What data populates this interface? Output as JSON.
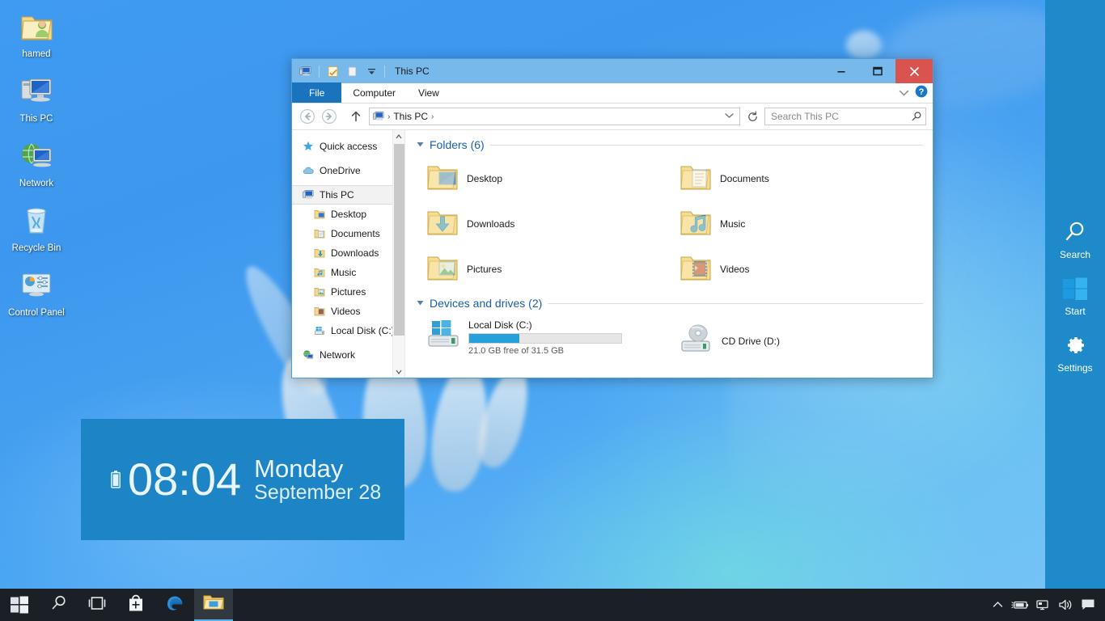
{
  "desktop": {
    "icons": [
      {
        "label": "hamed",
        "icon": "user-folder-icon"
      },
      {
        "label": "This PC",
        "icon": "computer-icon"
      },
      {
        "label": "Network",
        "icon": "network-icon"
      },
      {
        "label": "Recycle Bin",
        "icon": "recycle-bin-icon"
      },
      {
        "label": "Control Panel",
        "icon": "control-panel-icon"
      }
    ]
  },
  "clock_tile": {
    "time": "08:04",
    "day": "Monday",
    "month_day": "September 28",
    "battery_icon": "battery-icon",
    "background": "#1d84c6"
  },
  "charms": {
    "background": "#1f8ac9",
    "items": [
      {
        "label": "Search",
        "icon": "search-icon"
      },
      {
        "label": "Start",
        "icon": "windows-logo-icon"
      },
      {
        "label": "Settings",
        "icon": "gear-icon"
      }
    ]
  },
  "explorer": {
    "titlebar": {
      "title": "This PC",
      "app_icon": "this-pc-icon",
      "quick_access": [
        {
          "name": "properties-icon"
        },
        {
          "name": "new-folder-icon"
        },
        {
          "name": "customize-qat-chevron-icon"
        }
      ],
      "minimize_label": "–",
      "maximize_label": "▭",
      "close_label": "×",
      "close_color": "#d9534f",
      "background": "#78b9ec"
    },
    "ribbon": {
      "tabs": [
        {
          "label": "File",
          "active": true
        },
        {
          "label": "Computer",
          "active": false
        },
        {
          "label": "View",
          "active": false
        }
      ],
      "expand_icon": "chevron-down-icon",
      "help_icon": "help-icon",
      "file_tab_color": "#1a74bd"
    },
    "address_bar": {
      "back_icon": "back-arrow-icon",
      "forward_icon": "forward-arrow-icon",
      "up_icon": "up-arrow-icon",
      "crumb_icon": "this-pc-icon",
      "crumbs": [
        "This PC"
      ],
      "separator": "›",
      "dropdown_icon": "chevron-down-icon",
      "refresh_icon": "refresh-icon",
      "search_placeholder": "Search This PC",
      "search_value": "",
      "search_icon": "search-icon"
    },
    "nav_pane": {
      "items": [
        {
          "label": "Quick access",
          "icon": "star-icon",
          "level": 0,
          "selected": false
        },
        {
          "label": "OneDrive",
          "icon": "onedrive-icon",
          "level": 0,
          "selected": false
        },
        {
          "label": "This PC",
          "icon": "this-pc-icon",
          "level": 0,
          "selected": true
        },
        {
          "label": "Desktop",
          "icon": "desktop-folder-icon",
          "level": 1,
          "selected": false
        },
        {
          "label": "Documents",
          "icon": "documents-folder-icon",
          "level": 1,
          "selected": false
        },
        {
          "label": "Downloads",
          "icon": "downloads-folder-icon",
          "level": 1,
          "selected": false
        },
        {
          "label": "Music",
          "icon": "music-folder-icon",
          "level": 1,
          "selected": false
        },
        {
          "label": "Pictures",
          "icon": "pictures-folder-icon",
          "level": 1,
          "selected": false
        },
        {
          "label": "Videos",
          "icon": "videos-folder-icon",
          "level": 1,
          "selected": false
        },
        {
          "label": "Local Disk (C:)",
          "icon": "local-disk-icon",
          "level": 1,
          "selected": false
        },
        {
          "label": "Network",
          "icon": "network-icon",
          "level": 0,
          "selected": false
        }
      ],
      "scrollbar": {
        "up_icon": "▲",
        "down_icon": "▼"
      }
    },
    "content": {
      "folders_group": {
        "title": "Folders (6)",
        "collapse_icon": "triangle-down-icon",
        "items": [
          {
            "label": "Desktop",
            "icon": "desktop-folder-icon"
          },
          {
            "label": "Documents",
            "icon": "documents-folder-icon"
          },
          {
            "label": "Downloads",
            "icon": "downloads-folder-icon"
          },
          {
            "label": "Music",
            "icon": "music-folder-icon"
          },
          {
            "label": "Pictures",
            "icon": "pictures-folder-icon"
          },
          {
            "label": "Videos",
            "icon": "videos-folder-icon"
          }
        ]
      },
      "devices_group": {
        "title": "Devices and drives (2)",
        "collapse_icon": "triangle-down-icon",
        "drives": [
          {
            "name": "Local Disk (C:)",
            "icon": "local-disk-icon",
            "free_text": "21.0 GB free of 31.5 GB",
            "used_percent": 33,
            "bar_color": "#26a0da",
            "has_bar": true
          },
          {
            "name": "CD Drive (D:)",
            "icon": "cd-drive-icon",
            "free_text": "",
            "used_percent": 0,
            "bar_color": "",
            "has_bar": false
          }
        ]
      }
    }
  },
  "taskbar": {
    "background": "#1b2027",
    "start": {
      "icon": "windows-logo-icon"
    },
    "buttons": [
      {
        "icon": "search-icon",
        "name": "taskbar-search-button",
        "active": false
      },
      {
        "icon": "task-view-icon",
        "name": "taskbar-task-view-button",
        "active": false
      },
      {
        "icon": "store-icon",
        "name": "taskbar-store-button",
        "active": false
      },
      {
        "icon": "edge-icon",
        "name": "taskbar-edge-button",
        "active": false
      },
      {
        "icon": "file-explorer-icon",
        "name": "taskbar-file-explorer-button",
        "active": true
      }
    ],
    "tray": [
      {
        "icon": "chevron-up-icon",
        "name": "tray-show-hidden-icons"
      },
      {
        "icon": "battery-icon",
        "name": "tray-battery"
      },
      {
        "icon": "network-icon",
        "name": "tray-network"
      },
      {
        "icon": "volume-icon",
        "name": "tray-volume"
      },
      {
        "icon": "action-center-icon",
        "name": "tray-action-center"
      }
    ]
  }
}
